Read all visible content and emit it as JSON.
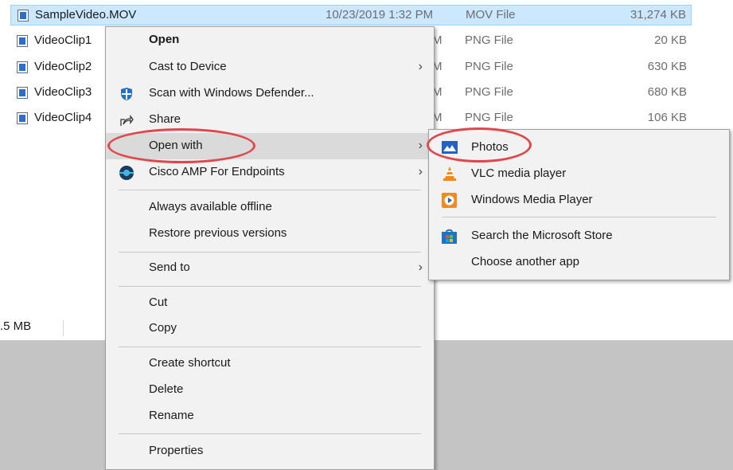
{
  "files": [
    {
      "name": "SampleVideo.MOV",
      "date": "10/23/2019 1:32 PM",
      "type": "MOV File",
      "size": "31,274 KB",
      "selected": true
    },
    {
      "name": "VideoClip1",
      "date": "M",
      "type": "PNG File",
      "size": "20 KB"
    },
    {
      "name": "VideoClip2",
      "date": "M",
      "type": "PNG File",
      "size": "630 KB"
    },
    {
      "name": "VideoClip3",
      "date": "M",
      "type": "PNG File",
      "size": "680 KB"
    },
    {
      "name": "VideoClip4",
      "date": "M",
      "type": "PNG File",
      "size": "106 KB"
    }
  ],
  "status_bar": {
    "size_text": ".5 MB"
  },
  "context_menu": {
    "open": "Open",
    "cast_to_device": "Cast to Device",
    "scan_defender": "Scan with Windows Defender...",
    "share": "Share",
    "open_with": "Open with",
    "cisco_amp": "Cisco AMP For Endpoints",
    "always_offline": "Always available offline",
    "restore_versions": "Restore previous versions",
    "send_to": "Send to",
    "cut": "Cut",
    "copy": "Copy",
    "create_shortcut": "Create shortcut",
    "delete": "Delete",
    "rename": "Rename",
    "properties": "Properties",
    "chevron": "›"
  },
  "open_with_submenu": {
    "photos": "Photos",
    "vlc": "VLC media player",
    "wmp": "Windows Media Player",
    "store": "Search the Microsoft Store",
    "choose_app": "Choose another app"
  },
  "icons": {
    "file": "image-file-icon",
    "defender": "windows-defender-shield-icon",
    "share": "share-icon",
    "cisco": "cisco-amp-icon",
    "photos": "photos-app-icon",
    "vlc": "vlc-cone-icon",
    "wmp": "windows-media-player-icon",
    "store": "microsoft-store-icon"
  },
  "colors": {
    "selection_bg": "#cce8ff",
    "menu_bg": "#f2f2f2",
    "menu_hover": "#dadada",
    "annotation": "#e0474c"
  }
}
